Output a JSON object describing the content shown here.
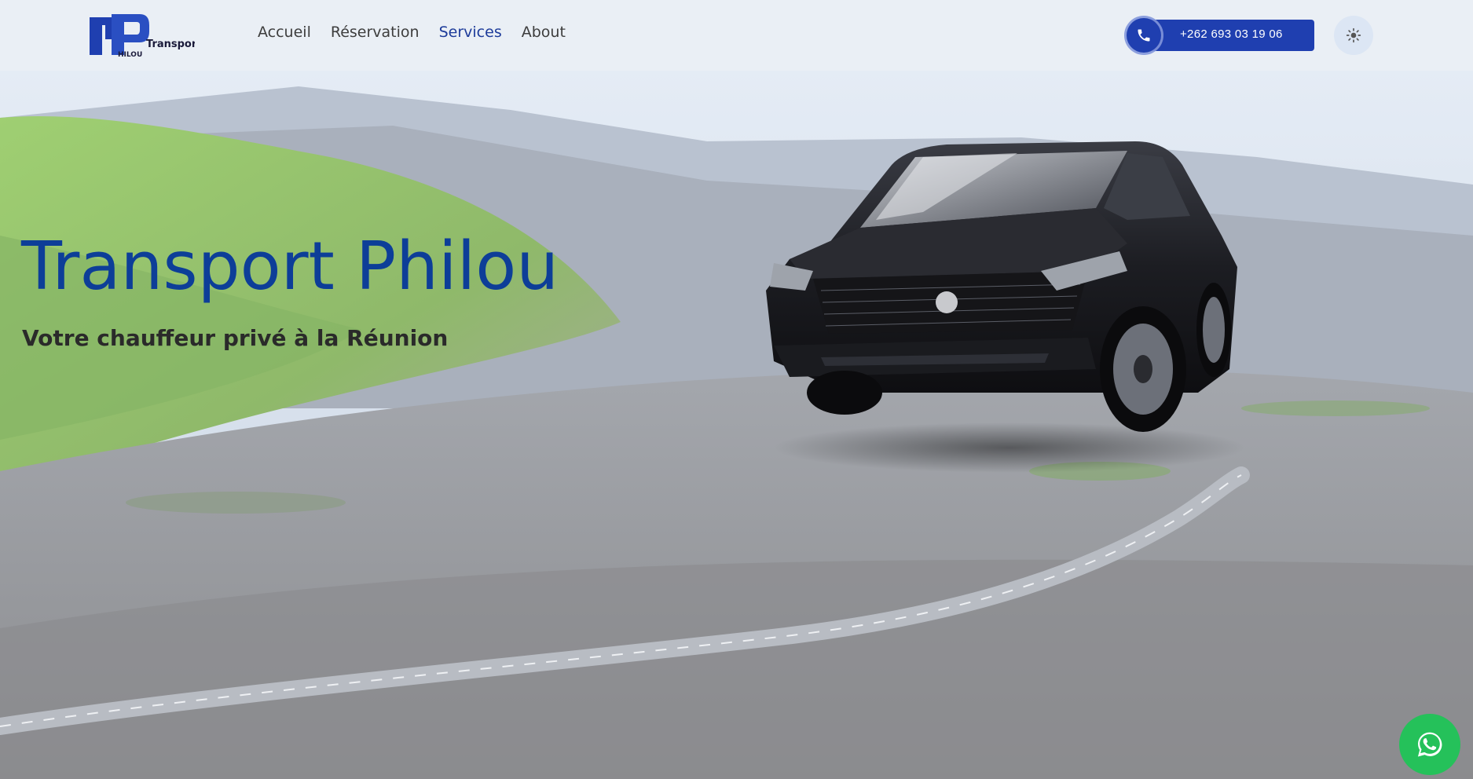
{
  "header": {
    "logo": {
      "text": "Transport",
      "sub_text": "HILOU"
    },
    "nav": [
      {
        "label": "Accueil",
        "active": false
      },
      {
        "label": "Réservation",
        "active": false
      },
      {
        "label": "Services",
        "active": true
      },
      {
        "label": "About",
        "active": false
      }
    ],
    "phone": {
      "label": "+262 693 03 19 06",
      "icon": "phone-icon"
    },
    "theme_toggle": {
      "icon": "sun-icon"
    }
  },
  "hero": {
    "title": "Transport Philou",
    "subtitle": "Votre chauffeur privé à la Réunion"
  },
  "floating": {
    "whatsapp_icon": "whatsapp-icon"
  },
  "colors": {
    "brand_blue": "#1f3fb0",
    "title_blue": "#0d3e98",
    "nav_active": "#1d3b9a",
    "whatsapp_green": "#25c15a"
  }
}
